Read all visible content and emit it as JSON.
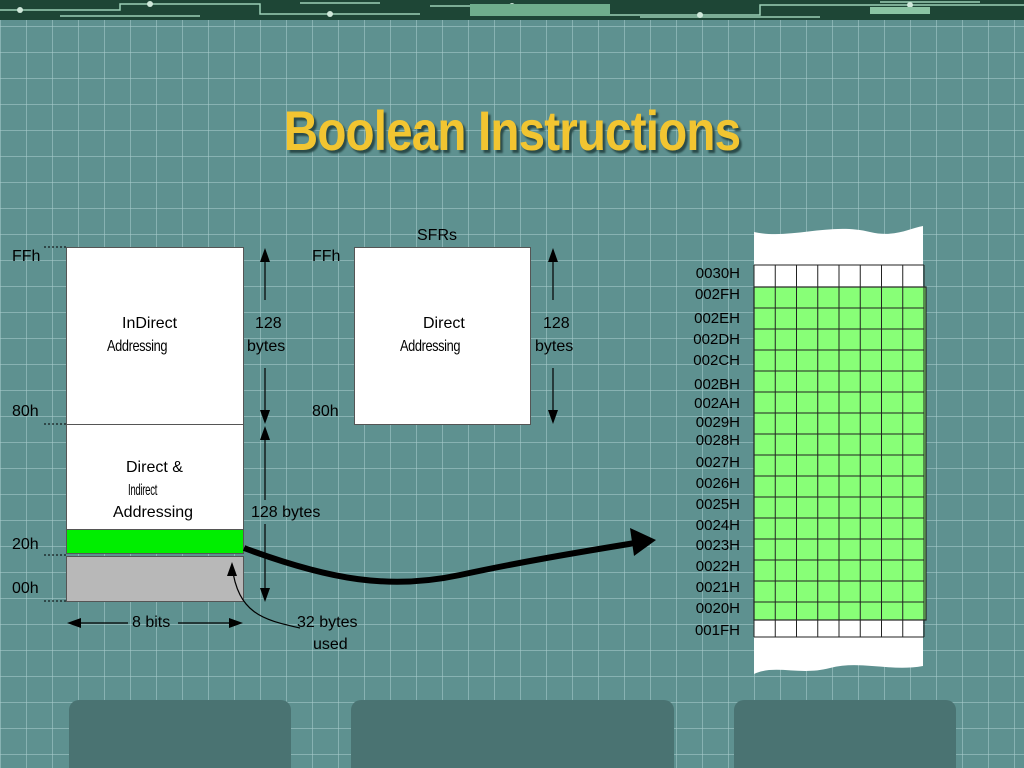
{
  "slide": {
    "title": "Boolean Instructions"
  },
  "left_memory": {
    "addresses": {
      "top": "FFh",
      "mid": "80h",
      "bit_area": "20h",
      "bottom": "00h"
    },
    "upper_block": {
      "line1": "InDirect",
      "line2": "Addressing",
      "size_num": "128",
      "size_unit": "bytes"
    },
    "lower_block": {
      "line1": "Direct &",
      "line2": "Indirect",
      "line3": "Addressing",
      "size": "128 bytes"
    },
    "width_label": "8 bits",
    "used_label_1": "32 bytes",
    "used_label_2": "used",
    "colors": {
      "bit_area": "#00ee00",
      "register_area": "#b8b8b8"
    }
  },
  "sfr_block": {
    "header": "SFRs",
    "addresses": {
      "top": "FFh",
      "bottom": "80h"
    },
    "line1": "Direct",
    "line2": "Addressing",
    "size_num": "128",
    "size_unit": "bytes"
  },
  "bit_memory": {
    "addresses": [
      "0030H",
      "002FH",
      "002EH",
      "002DH",
      "002CH",
      "002BH",
      "002AH",
      "0029H",
      "0028H",
      "0027H",
      "0026H",
      "0025H",
      "0024H",
      "0023H",
      "0022H",
      "0021H",
      "0020H",
      "001FH"
    ],
    "colors": {
      "grid_fill": "#88ff77",
      "grid_line": "#222222"
    }
  }
}
